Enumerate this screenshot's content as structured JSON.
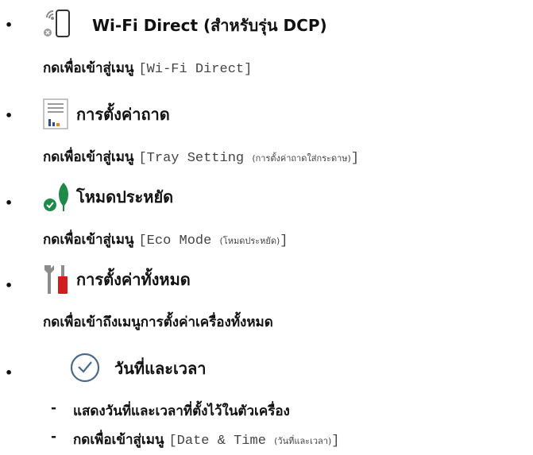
{
  "items": [
    {
      "icon": "wifi-direct-icon",
      "title": "Wi-Fi Direct (สำหรับรุ่น DCP)",
      "desc_prefix": "กดเพื่อเข้าสู่เมนู",
      "desc_code": "[Wi-Fi Direct]"
    },
    {
      "icon": "tray-setting-icon",
      "title": "การตั้งค่าถาด",
      "desc_prefix": "กดเพื่อเข้าสู่เมนู",
      "desc_code_open": "[Tray Setting ",
      "desc_code_thai": "(การตั้งค่าถาดใส่กระดาษ)",
      "desc_code_close": "]"
    },
    {
      "icon": "eco-leaf-icon",
      "title": "โหมดประหยัด",
      "desc_prefix": "กดเพื่อเข้าสู่เมนู",
      "desc_code_open": "[Eco Mode ",
      "desc_code_thai": "(โหมดประหยัด)",
      "desc_code_close": "]"
    },
    {
      "icon": "all-settings-tools-icon",
      "title": "การตั้งค่าทั้งหมด",
      "desc": "กดเพื่อเข้าถึงเมนูการตั้งค่าเครื่องทั้งหมด"
    },
    {
      "icon": "clock-icon",
      "title": "วันที่และเวลา",
      "sub1": "แสดงวันที่และเวลาที่ตั้งไว้ในตัวเครื่อง",
      "sub2_prefix": "กดเพื่อเข้าสู่เมนู",
      "sub2_code_open": "[Date & Time ",
      "sub2_code_thai": "(วันที่และเวลา)",
      "sub2_code_close": "]"
    }
  ],
  "bullet": "•",
  "dash": "-"
}
